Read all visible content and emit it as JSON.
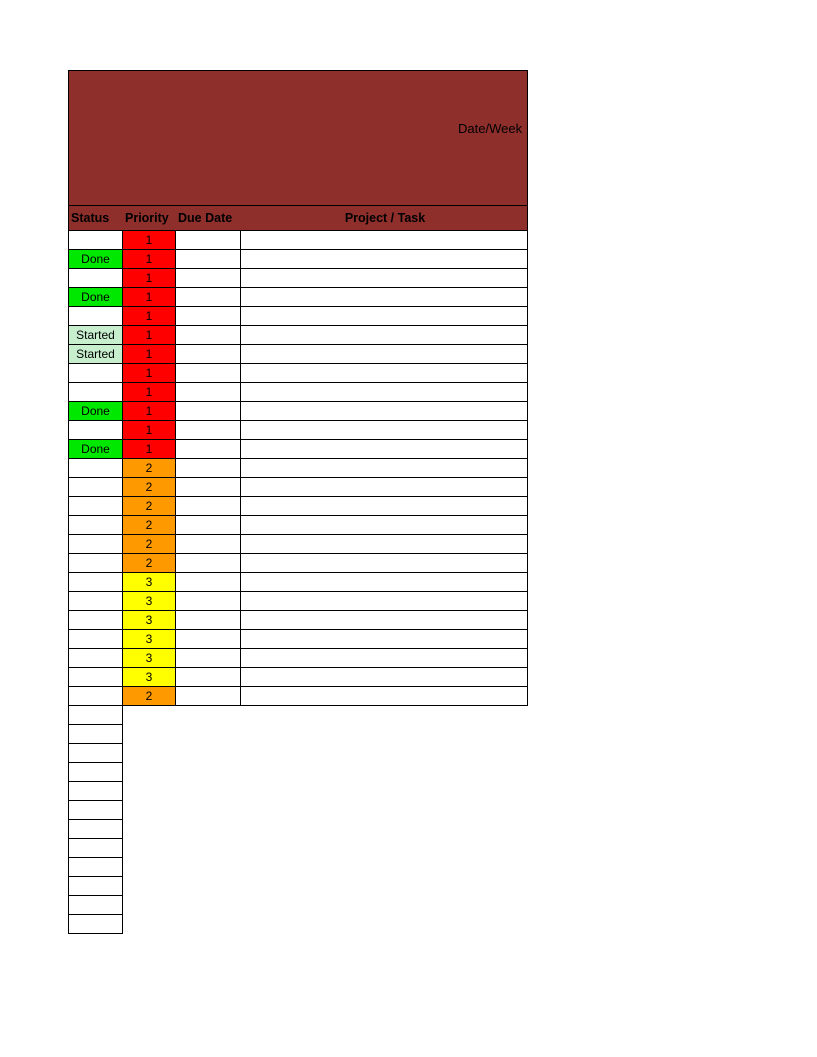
{
  "header": {
    "date_week_label": "Date/Week",
    "columns": {
      "status": "Status",
      "priority": "Priority",
      "due_date": "Due Date",
      "project_task": "Project / Task"
    }
  },
  "colors": {
    "header_bg": "#8e2f2b",
    "status": {
      "Done": "#00e800",
      "Started": "#c7efce"
    },
    "priority": {
      "1": "#ff0000",
      "2": "#ff9900",
      "3": "#ffff00"
    }
  },
  "rows": [
    {
      "status": "",
      "priority": 1,
      "due_date": "",
      "project_task": ""
    },
    {
      "status": "Done",
      "priority": 1,
      "due_date": "",
      "project_task": ""
    },
    {
      "status": "",
      "priority": 1,
      "due_date": "",
      "project_task": ""
    },
    {
      "status": "Done",
      "priority": 1,
      "due_date": "",
      "project_task": ""
    },
    {
      "status": "",
      "priority": 1,
      "due_date": "",
      "project_task": ""
    },
    {
      "status": "Started",
      "priority": 1,
      "due_date": "",
      "project_task": ""
    },
    {
      "status": "Started",
      "priority": 1,
      "due_date": "",
      "project_task": ""
    },
    {
      "status": "",
      "priority": 1,
      "due_date": "",
      "project_task": ""
    },
    {
      "status": "",
      "priority": 1,
      "due_date": "",
      "project_task": ""
    },
    {
      "status": "Done",
      "priority": 1,
      "due_date": "",
      "project_task": ""
    },
    {
      "status": "",
      "priority": 1,
      "due_date": "",
      "project_task": ""
    },
    {
      "status": "Done",
      "priority": 1,
      "due_date": "",
      "project_task": ""
    },
    {
      "status": "",
      "priority": 2,
      "due_date": "",
      "project_task": ""
    },
    {
      "status": "",
      "priority": 2,
      "due_date": "",
      "project_task": ""
    },
    {
      "status": "",
      "priority": 2,
      "due_date": "",
      "project_task": ""
    },
    {
      "status": "",
      "priority": 2,
      "due_date": "",
      "project_task": ""
    },
    {
      "status": "",
      "priority": 2,
      "due_date": "",
      "project_task": ""
    },
    {
      "status": "",
      "priority": 2,
      "due_date": "",
      "project_task": ""
    },
    {
      "status": "",
      "priority": 3,
      "due_date": "",
      "project_task": ""
    },
    {
      "status": "",
      "priority": 3,
      "due_date": "",
      "project_task": ""
    },
    {
      "status": "",
      "priority": 3,
      "due_date": "",
      "project_task": ""
    },
    {
      "status": "",
      "priority": 3,
      "due_date": "",
      "project_task": ""
    },
    {
      "status": "",
      "priority": 3,
      "due_date": "",
      "project_task": ""
    },
    {
      "status": "",
      "priority": 3,
      "due_date": "",
      "project_task": ""
    },
    {
      "status": "",
      "priority": 2,
      "due_date": "",
      "project_task": ""
    }
  ],
  "tail_empty_rows": 12
}
